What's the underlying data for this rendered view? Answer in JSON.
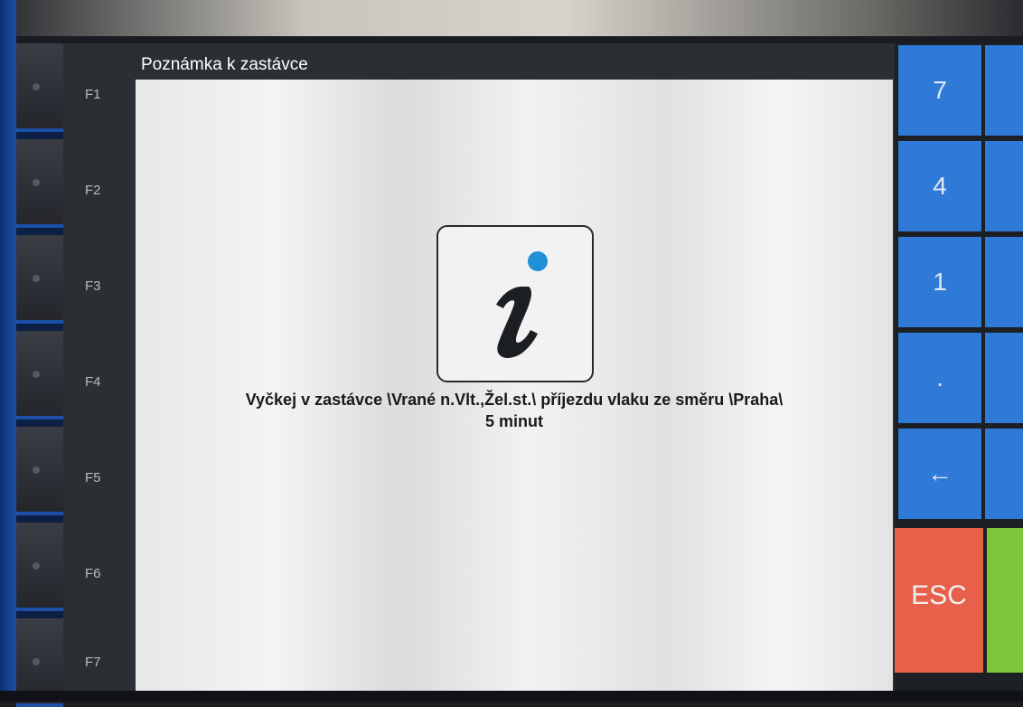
{
  "window": {
    "title": "Poznámka k zastávce"
  },
  "function_keys": [
    "F1",
    "F2",
    "F3",
    "F4",
    "F5",
    "F6",
    "F7"
  ],
  "message": {
    "line1": "Vyčkej v zastávce \\Vrané n.Vlt.,Žel.st.\\ příjezdu vlaku ze směru \\Praha\\",
    "line2": "5 minut"
  },
  "icon": {
    "name": "info-icon",
    "glyph": "i"
  },
  "keypad": {
    "keys": [
      "7",
      "4",
      "1",
      ".",
      "←",
      "ESC"
    ]
  },
  "colors": {
    "keypad_blue": "#2f7ad6",
    "esc_red": "#e8604a",
    "ok_green": "#7cc63a",
    "info_dot": "#1e90d6"
  }
}
